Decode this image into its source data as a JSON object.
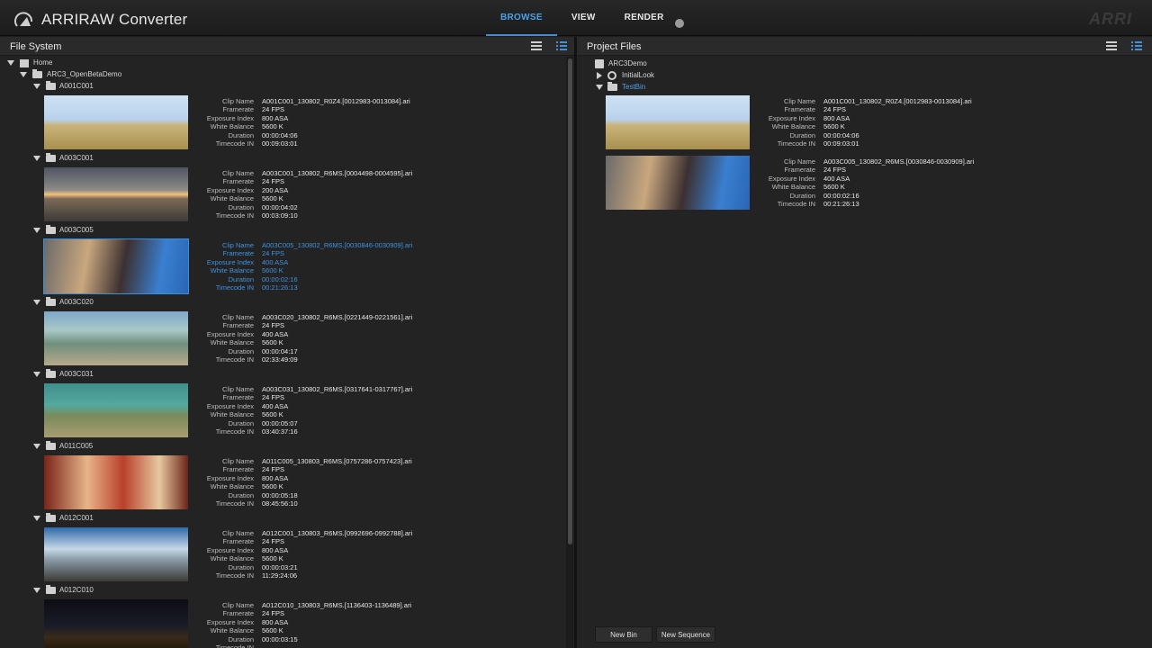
{
  "app": {
    "title": "ARRIRAW Converter",
    "brand": "ARRI"
  },
  "nav": {
    "tabs": [
      {
        "label": "BROWSE",
        "active": true
      },
      {
        "label": "VIEW"
      },
      {
        "label": "RENDER"
      }
    ]
  },
  "colors": {
    "accent": "#3a8ee0",
    "background": "#1d1d1d",
    "panel": "#232323"
  },
  "meta_labels": {
    "clip_name": "Clip Name",
    "framerate": "Framerate",
    "exposure_index": "Exposure Index",
    "white_balance": "White Balance",
    "duration": "Duration",
    "timecode_in": "Timecode IN"
  },
  "file_system": {
    "title": "File System",
    "home": "Home",
    "root_folder": "ARC3_OpenBetaDemo",
    "clips": [
      {
        "folder": "A001C001",
        "clip_name": "A001C001_130802_R0Z4.[0012983-0013084].ari",
        "framerate": "24 FPS",
        "exposure_index": "800 ASA",
        "white_balance": "5600 K",
        "duration": "00:00:04:06",
        "timecode_in": "00:09:03:01"
      },
      {
        "folder": "A003C001",
        "clip_name": "A003C001_130802_R6MS.[0004498-0004595].ari",
        "framerate": "24 FPS",
        "exposure_index": "200 ASA",
        "white_balance": "5600 K",
        "duration": "00:00:04:02",
        "timecode_in": "00:03:09:10"
      },
      {
        "folder": "A003C005",
        "clip_name": "A003C005_130802_R6MS.[0030846-0030909].ari",
        "framerate": "24 FPS",
        "exposure_index": "400 ASA",
        "white_balance": "5600 K",
        "duration": "00:00:02:16",
        "timecode_in": "00:21:26:13",
        "selected": true
      },
      {
        "folder": "A003C020",
        "clip_name": "A003C020_130802_R6MS.[0221449-0221561].ari",
        "framerate": "24 FPS",
        "exposure_index": "400 ASA",
        "white_balance": "5600 K",
        "duration": "00:00:04:17",
        "timecode_in": "02:33:49:09"
      },
      {
        "folder": "A003C031",
        "clip_name": "A003C031_130802_R6MS.[0317641-0317767].ari",
        "framerate": "24 FPS",
        "exposure_index": "400 ASA",
        "white_balance": "5600 K",
        "duration": "00:00:05:07",
        "timecode_in": "03:40:37:16"
      },
      {
        "folder": "A011C005",
        "clip_name": "A011C005_130803_R6MS.[0757286-0757423].ari",
        "framerate": "24 FPS",
        "exposure_index": "800 ASA",
        "white_balance": "5600 K",
        "duration": "00:00:05:18",
        "timecode_in": "08:45:56:10"
      },
      {
        "folder": "A012C001",
        "clip_name": "A012C001_130803_R6MS.[0992696-0992788].ari",
        "framerate": "24 FPS",
        "exposure_index": "800 ASA",
        "white_balance": "5600 K",
        "duration": "00:00:03:21",
        "timecode_in": "11:29:24:06"
      },
      {
        "folder": "A012C010",
        "clip_name": "A012C010_130803_R6MS.[1136403-1136489].ari",
        "framerate": "24 FPS",
        "exposure_index": "800 ASA",
        "white_balance": "5600 K",
        "duration": "00:00:03:15",
        "timecode_in": ""
      }
    ]
  },
  "project_files": {
    "title": "Project Files",
    "project": "ARC3Demo",
    "look": "InitialLook",
    "bin": "TestBin",
    "clips": [
      {
        "clip_name": "A001C001_130802_R0Z4.[0012983-0013084].ari",
        "framerate": "24 FPS",
        "exposure_index": "800 ASA",
        "white_balance": "5600 K",
        "duration": "00:00:04:06",
        "timecode_in": "00:09:03:01"
      },
      {
        "clip_name": "A003C005_130802_R6MS.[0030846-0030909].ari",
        "framerate": "24 FPS",
        "exposure_index": "400 ASA",
        "white_balance": "5600 K",
        "duration": "00:00:02:16",
        "timecode_in": "00:21:26:13"
      }
    ],
    "buttons": {
      "new_bin": "New Bin",
      "new_sequence": "New Sequence"
    }
  }
}
